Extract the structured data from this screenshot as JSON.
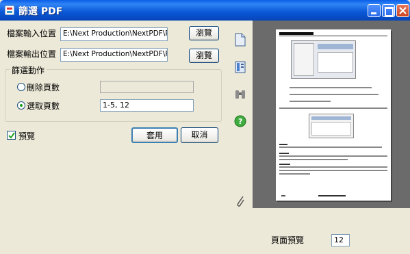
{
  "window": {
    "title": "篩選 PDF"
  },
  "input": {
    "label": "檔案輸入位置",
    "value": "E:\\Next Production\\NextPDF\\PDFv3_on\\M",
    "browse_label": "瀏覽"
  },
  "output": {
    "label": "檔案輸出位置",
    "value": "E:\\Next Production\\NextPDF\\PDFv3_on\\M",
    "browse_label": "瀏覽"
  },
  "filter": {
    "group_label": "篩選動作",
    "delete_pages": {
      "label": "刪除頁數",
      "value": "",
      "selected": false
    },
    "select_pages": {
      "label": "選取頁數",
      "value": "1-5, 12",
      "selected": true
    }
  },
  "preview": {
    "label": "預覽",
    "checked": true
  },
  "buttons": {
    "apply": "套用",
    "cancel": "取消"
  },
  "page_preview": {
    "label": "頁面預覽",
    "value": "12"
  },
  "toolbar": {
    "icons": [
      "document-icon",
      "bookmark-icon",
      "binoculars-icon",
      "help-icon",
      "attachment-icon"
    ]
  }
}
